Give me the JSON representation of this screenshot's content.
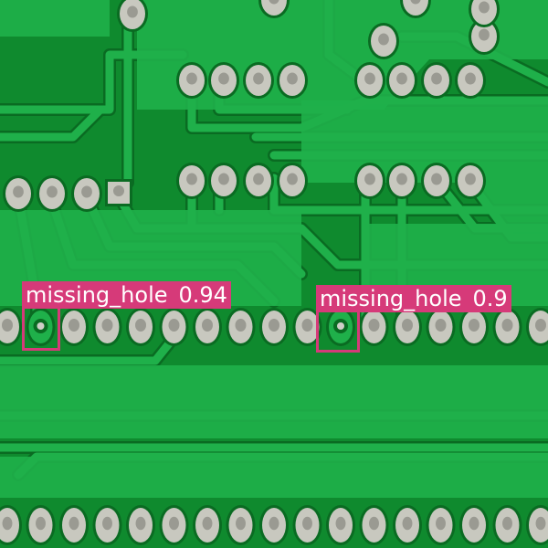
{
  "image": {
    "subject": "green printed circuit board with rows of through-hole solder pads and copper traces",
    "colors": {
      "board": "#0f8a2e",
      "trace": "#1fb04a",
      "trace_edge": "#0a6b22",
      "pad": "#c8c8bf",
      "pad_hole": "#9a9a92",
      "detection": "#d63a79",
      "label_text": "#ffffff"
    }
  },
  "detections": [
    {
      "label": "missing_hole",
      "score": "0.94"
    },
    {
      "label": "missing_hole",
      "score": "0.9"
    }
  ]
}
